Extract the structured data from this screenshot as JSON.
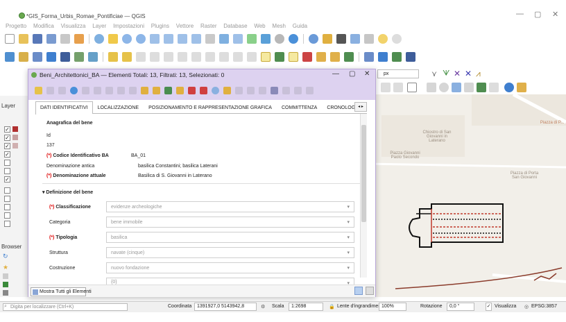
{
  "window": {
    "title": "*GIS_Forma_Urbis_Romae_Pontificiae — QGIS",
    "minimize": "—",
    "maximize": "▢",
    "close": "✕"
  },
  "menubar": {
    "items": [
      "Progetto",
      "Modifica",
      "Visualizza",
      "Layer",
      "Impostazioni",
      "Plugins",
      "Vettore",
      "Raster",
      "Database",
      "Web",
      "Mesh",
      "Guida"
    ]
  },
  "layers_panel": {
    "title": "Layer"
  },
  "browser_panel": {
    "title": "Browser"
  },
  "scale_field": {
    "unit": "px"
  },
  "dialog": {
    "title": "Beni_Architettonici_BA — Elementi Totali: 13, Filtrati: 13, Selezionati: 0",
    "minimize": "—",
    "maximize": "▢",
    "close": "✕",
    "tabs": [
      "DATI IDENTIFICATIVI",
      "LOCALIZZAZIONE",
      "POSIZIONAMENTO E RAPPRESENTAZIONE GRAFICA",
      "COMMITTENZA",
      "CRONOLOGIA"
    ],
    "section1": {
      "title": "Anagrafica del bene",
      "id_label": "Id",
      "id_value": "137",
      "req_marker": "(*)",
      "codice_label": "Codice Identificativo BA",
      "codice_value": "BA_01",
      "denom_antica_label": "Denominazione antica",
      "denom_antica_value": "basilica Constantini; basilica Laterani",
      "denom_attuale_label": "Denominazione attuale",
      "denom_attuale_value": "Basilica di S. Giovanni in Laterano"
    },
    "section2": {
      "title": "Definizione del bene",
      "classificazione_label": "Classificazione",
      "classificazione_value": "evidenze archeologiche",
      "categoria_label": "Categoria",
      "categoria_value": "bene immobile",
      "tipologia_label": "Tipologia",
      "tipologia_value": "basilica",
      "struttura_label": "Struttura",
      "struttura_value": "navate (cinque)",
      "costruzione_label": "Costruzione",
      "costruzione_value": "nuovo fondazione",
      "extra_value": "{0}"
    },
    "show_all_button": "Mostra Tutti gli Elementi"
  },
  "map": {
    "labels": [
      "Chiostro di San Giovanni in Laterano",
      "Piazza Giovanni Paolo Secondo",
      "Piazza di Porta San Giovanni",
      "Piazza di P..."
    ]
  },
  "statusbar": {
    "locator_placeholder": "Digita per localizzare (Ctrl+K)",
    "coord_label": "Coordinata",
    "coord_value": "1391927,0  5143942,8",
    "scale_label": "Scala",
    "scale_value": "1:2698",
    "magnifier_label": "Lente d'ingrandimento",
    "magnifier_value": "100%",
    "rotation_label": "Rotazione",
    "rotation_value": "0,0 °",
    "render_label": "Visualizza",
    "crs": "EPSG:3857"
  },
  "colors": {
    "dialog_header": "#ddd2f0",
    "required_marker": "#dd0000",
    "map_background": "#f2efe9",
    "feature_outline": "#111111",
    "feature_dashes": "#c0392b"
  }
}
